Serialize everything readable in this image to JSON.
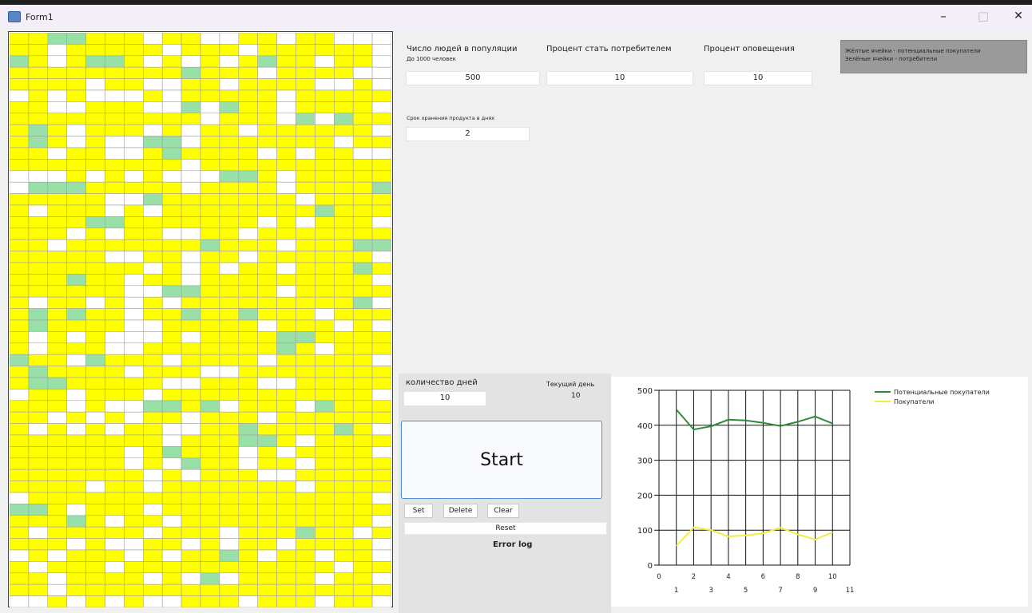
{
  "window": {
    "title": "Form1",
    "minimize": "–",
    "maximize": "□",
    "close": "✕"
  },
  "inputs": {
    "population_label": "Число людей в популяции",
    "population_hint": "До 1000 человек",
    "population_value": "500",
    "consumer_label": "Процент стать потребителем",
    "consumer_value": "10",
    "notify_label": "Процент оповещения",
    "notify_value": "10",
    "shelf_label": "Срок хранения продукта в днях",
    "shelf_value": "2"
  },
  "legend_box": {
    "line1": "Жёлтые ячейки - потенциальные покупатели",
    "line2": "Зелёные ячейки - потребители"
  },
  "controls": {
    "days_label": "количество дней",
    "days_value": "10",
    "current_day_label": "Текущий день",
    "current_day_value": "10",
    "start_label": "Start",
    "set_label": "Set",
    "delete_label": "Delete",
    "clear_label": "Clear",
    "reset_label": "Reset",
    "error_log_label": "Error log"
  },
  "colors": {
    "potential": "#ffff00",
    "consumer": "#98e0a8",
    "empty": "#ffffff",
    "grid_line": "#a0a0a0",
    "series_potential": "#2e8b3a",
    "series_buyers": "#f0ef40"
  },
  "grid": {
    "rows": 50,
    "cols": 20,
    "cells": [
      "YYGGYYYWYYWWYYWYYWWW",
      "YYWYYYYYWYYYWYYYYYYW",
      "GYWYGGYWYWYWYGYYWYYW",
      "YYYYYYYYYGYYYWYYYYWW",
      "YYYYWYYWWYYWYYYYWWYW",
      "WYWYWWWYWYYYYYWYYYYY",
      "YYWWYYYWWGWGYYWYYYYW",
      "YYYYYYYYYYWYYYWGWGYY",
      "YGYWYYYWYWYYWYYYYYYW",
      "YGYWYWWGGWYYYYYYYWYY",
      "YYWYYWWYGYYYYWYWYYWW",
      "YYYYYYYYYWYYYYYYYYYY",
      "WWWYWYWYWWWGGYWYYYYY",
      "WGGGYYYYYWYYYYWYYYYG",
      "YYYYYWWGYYYYYYYWYYYY",
      "YWYYYWYWYYYYYYYYGYYY",
      "YYYYGGYYYYYYYWYWYYYW",
      "YYYWYWYYWWYYWYYYYYYY",
      "YYWYYYYYYYGYYYWYYYGG",
      "YYYYYWWYYWYYWYYYYYYW",
      "YYYYYYYWYWYWYYWYYYGY",
      "YYYGYYWYYWYYYYYYYYYW",
      "YYYYYYWWGGYYYYWYYYYY",
      "YWYYWYWYWYYYYYYYYYGW",
      "YGYGYYWYYGYYGYYYWYYY",
      "YGYYYYWWYYYYYWYYYWYW",
      "YWYWYWWWYWYYYYGGYYYY",
      "YWYYYWWYYYYYYYGYWYYY",
      "GYYWGYYYWYYYYWYYYYYW",
      "YGYYYYWYYYWWYYYYYYYY",
      "YGGYYYYYWWYYYWWYYYYY",
      "WYYWYYYWYYYYYYYYYYYW",
      "YYYWYWWGGYGWYYYWGYYY",
      "YYWYWYWYYWYYYWYYYYYY",
      "YWYWYWYYWWYYGYYYYGYW",
      "YYYYYYYYWYYYGGYWYYYY",
      "YYYYYYWYGYYYWYWYYYYW",
      "YYYYYYWYWGYYWYYWYYYY",
      "YYYYYYYWYWYYYWWYYYYY",
      "YYYYWYYWYYYYYYYWYYYY",
      "WYYYYYYYYYYYYYYYYYYW",
      "GGYWYYYWYYYYYYYYYYYY",
      "YYYGYWYYWYYYYYYYYYYW",
      "YWYYYYYWYYYWYYYGYYWY",
      "YYYWYWWYYWYWYYWYYYYW",
      "WYWYYYWYWYYGYWYYWYYW",
      "YWYYYWYYYYYYYYYYYWYY",
      "YYWYYYYWYWGWYYYYWYYW",
      "YYWYYYYYYYYYYYYYYYYY",
      "WWYWYWYWWYYYWYYYWYYW"
    ]
  },
  "chart_data": {
    "type": "line",
    "x_ticks": [
      "0",
      "1",
      "2",
      "3",
      "4",
      "5",
      "6",
      "7",
      "8",
      "9",
      "10",
      "11"
    ],
    "y_ticks": [
      "0",
      "100",
      "200",
      "300",
      "400",
      "500"
    ],
    "xlim": [
      0,
      11
    ],
    "ylim": [
      0,
      500
    ],
    "x": [
      1,
      2,
      3,
      4,
      5,
      6,
      7,
      8,
      9,
      10
    ],
    "series": [
      {
        "name": "Потенциальные покупатели",
        "color": "#2e8b3a",
        "values": [
          445,
          388,
          397,
          416,
          414,
          407,
          398,
          410,
          425,
          405
        ]
      },
      {
        "name": "Покупатели",
        "color": "#f0ef40",
        "values": [
          55,
          108,
          100,
          82,
          85,
          91,
          107,
          88,
          73,
          94
        ]
      }
    ],
    "grid": true,
    "legend_position": "top-right"
  }
}
